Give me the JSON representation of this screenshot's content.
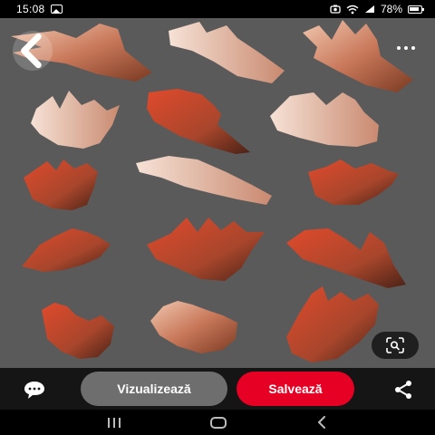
{
  "status_bar": {
    "time": "15:08",
    "battery": "78%",
    "icons": [
      "gallery-icon",
      "screenshot-icon",
      "wifi-icon",
      "signal-icon",
      "battery-icon"
    ]
  },
  "pin": {
    "description_icons": [
      "back-arrow-icon",
      "more-options-icon",
      "visual-search-icon"
    ],
    "background_color": "#5a5a5a"
  },
  "actions": {
    "visit_label": "Vizualizează",
    "save_label": "Salvează",
    "comment_icon": "comment-icon",
    "share_icon": "share-icon"
  },
  "nav": {
    "icons": [
      "recent-apps-icon",
      "home-icon",
      "back-icon"
    ]
  },
  "colors": {
    "accent": "#e60023",
    "secondary_button": "#6e6e6e",
    "bar_background": "#151515"
  }
}
